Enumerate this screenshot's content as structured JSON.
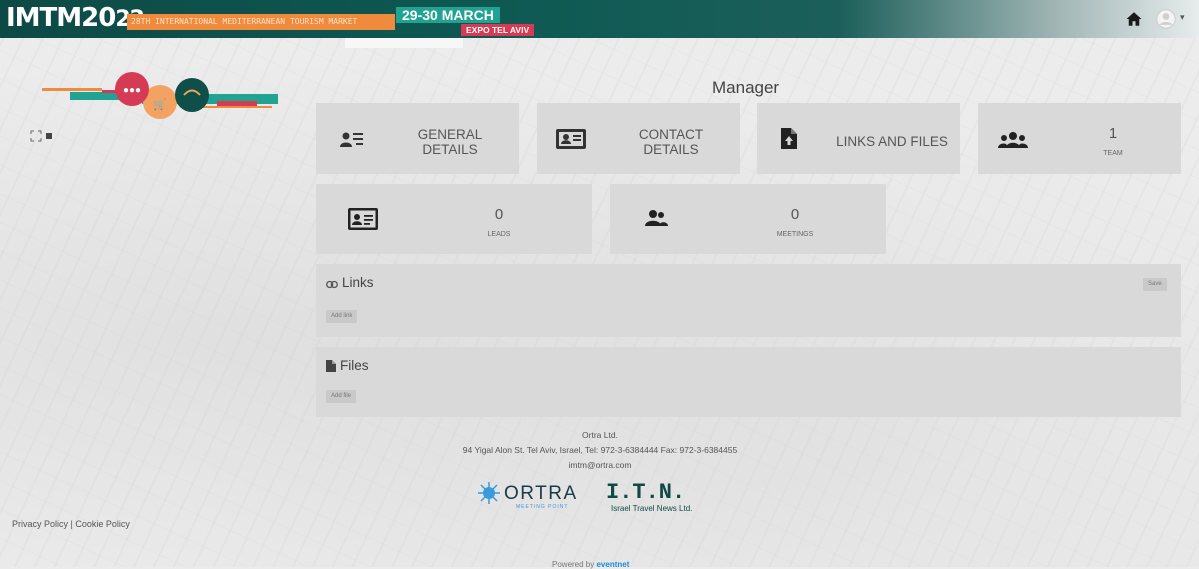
{
  "header": {
    "logo_text": "IMTM20",
    "logo_year": "22",
    "tagline": "28TH INTERNATIONAL MEDITERRANEAN TOURISM MARKET",
    "dates": "29-30 MARCH",
    "venue": "EXPO TEL AVIV",
    "icons": [
      "home-icon",
      "user-avatar-icon"
    ]
  },
  "page": {
    "title": "Manager"
  },
  "tiles": {
    "general": {
      "label1": "GENERAL",
      "label2": "DETAILS",
      "icon": "list-user-icon"
    },
    "contact": {
      "label1": "CONTACT",
      "label2": "DETAILS",
      "icon": "id-card-icon"
    },
    "links_files": {
      "label": "LINKS AND FILES",
      "icon": "file-upload-icon"
    },
    "team": {
      "count": "1",
      "label": "TEAM",
      "icon": "team-icon"
    },
    "leads": {
      "count": "0",
      "label": "LEADS",
      "icon": "contact-card-icon"
    },
    "meetings": {
      "count": "0",
      "label": "MEETINGS",
      "icon": "users-icon"
    }
  },
  "links_panel": {
    "title": "Links",
    "add_label": "Add link",
    "save_label": "Save"
  },
  "files_panel": {
    "title": "Files",
    "add_label": "Add file"
  },
  "footer": {
    "company": "Ortra Ltd.",
    "address": "94 Yigal Alon St. Tel Aviv, Israel, Tel: 972-3-6384444 Fax: 972-3-6384455",
    "email": "imtm@ortra.com",
    "ortra": "ORTRA",
    "ortra_sub": "MEETING POINT",
    "itn": "I.T.N.",
    "itn_sub": "Israel Travel News Ltd.",
    "privacy": "Privacy Policy",
    "separator": "|",
    "cookie": "Cookie Policy",
    "powered_prefix": "Powered by",
    "powered_brand": "eventnet"
  },
  "colors": {
    "banner": "#0f5a54",
    "tagline_bg": "#f08a3c",
    "dates_bg": "#21a394",
    "venue_bg": "#d63b55",
    "tile_bg": "#d9d9d9"
  }
}
